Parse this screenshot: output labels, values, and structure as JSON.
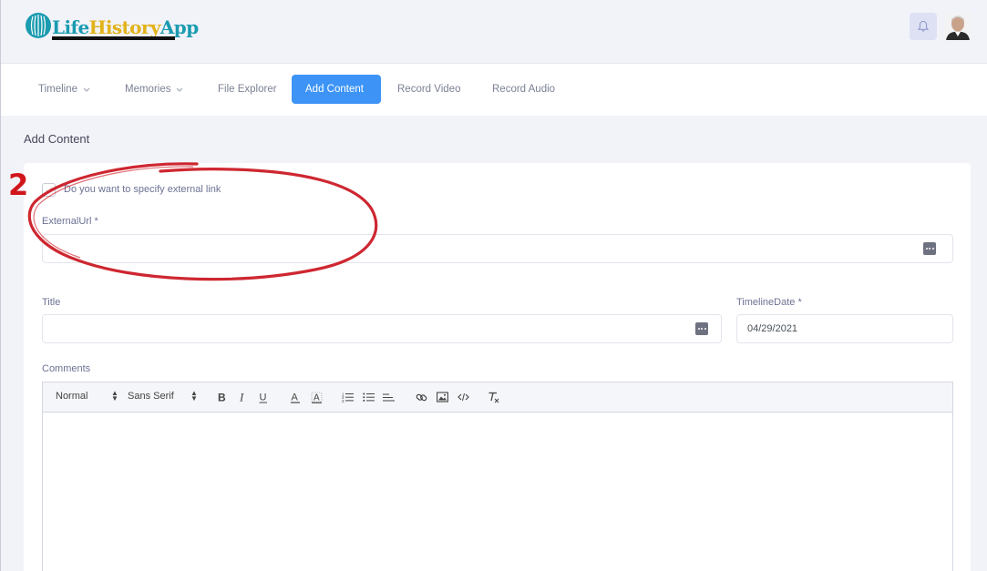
{
  "app": {
    "logo_text_1": "Life",
    "logo_text_2": "History",
    "logo_text_3": "App"
  },
  "nav": {
    "items": [
      {
        "label": "Timeline",
        "has_dropdown": true
      },
      {
        "label": "Memories",
        "has_dropdown": true
      },
      {
        "label": "File Explorer",
        "has_dropdown": false
      },
      {
        "label": "Add Content",
        "active": true
      },
      {
        "label": "Record Video",
        "has_dropdown": false
      },
      {
        "label": "Record Audio",
        "has_dropdown": false
      }
    ]
  },
  "page": {
    "title": "Add Content"
  },
  "form": {
    "external_link_checkbox_label": "Do you want to specify external link",
    "external_link_checked": false,
    "external_url_label": "ExternalUrl *",
    "external_url_value": "",
    "title_label": "Title",
    "title_value": "",
    "timeline_date_label": "TimelineDate *",
    "timeline_date_value": "04/29/2021",
    "comments_label": "Comments"
  },
  "editor": {
    "format_select": "Normal",
    "font_select": "Sans Serif",
    "buttons": [
      "bold",
      "italic",
      "underline",
      "font-color",
      "background-color",
      "ordered-list",
      "bullet-list",
      "align",
      "link",
      "image",
      "code",
      "clear-format"
    ]
  },
  "annotation": {
    "number": "2",
    "color": "#d0161c"
  },
  "colors": {
    "accent": "#3d94f6",
    "background": "#f2f3f8"
  }
}
